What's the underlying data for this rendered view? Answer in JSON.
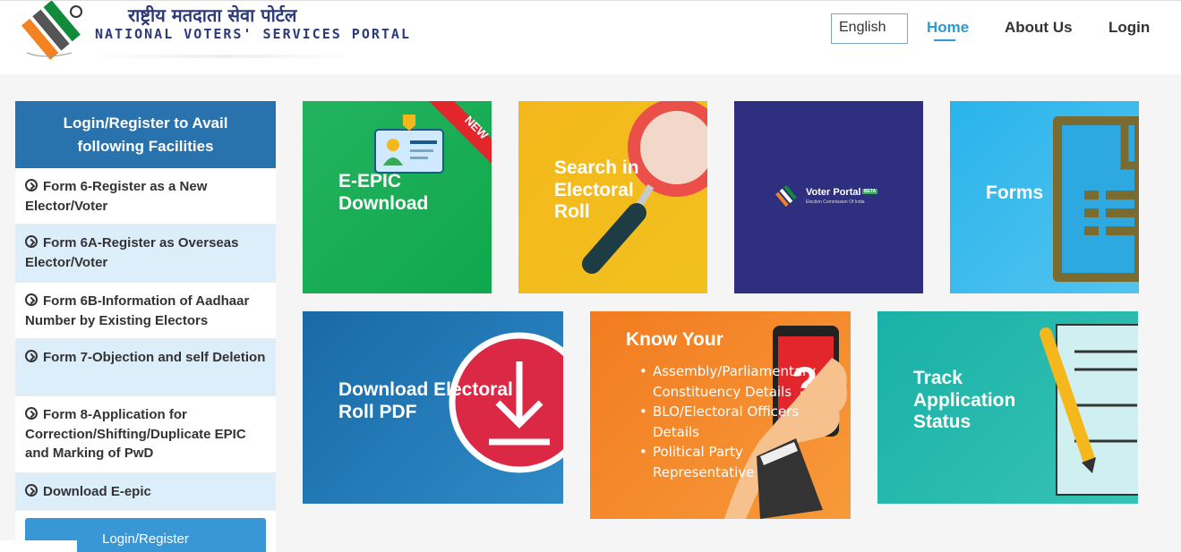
{
  "header": {
    "hindi_title": "राष्ट्रीय मतदाता सेवा पोर्टल",
    "english_title": "NATIONAL VOTERS' SERVICES PORTAL",
    "language": "English",
    "nav": {
      "home": "Home",
      "about": "About Us",
      "login": "Login"
    }
  },
  "sidebar": {
    "heading": "Login/Register to Avail following Facilities",
    "items": [
      {
        "label": "Form 6-Register as a New Elector/Voter"
      },
      {
        "label": "Form 6A-Register as Overseas Elector/Voter"
      },
      {
        "label": "Form 6B-Information of Aadhaar Number by Existing Electors"
      },
      {
        "label": "Form 7-Objection and self Deletion"
      },
      {
        "label": "Form 8-Application for Correction/Shifting/Duplicate EPIC and Marking of PwD"
      },
      {
        "label": "Download E-epic"
      }
    ],
    "button": "Login/Register"
  },
  "tiles": {
    "epic": {
      "title": "E-EPIC Download",
      "badge": "NEW"
    },
    "search": {
      "title": "Search in Electoral Roll"
    },
    "voter_portal": {
      "title": "Voter Portal",
      "badge": "BETA",
      "subtitle": "Election Commission Of India"
    },
    "forms": {
      "title": "Forms"
    },
    "download_roll": {
      "title": "Download Electoral Roll PDF"
    },
    "know": {
      "title": "Know Your",
      "items": [
        "Assembly/Parliamentary Constituency Details",
        "BLO/Electoral Officers Details",
        "Political Party Representative"
      ]
    },
    "track": {
      "title": "Track Application Status"
    }
  },
  "colors": {
    "primary": "#2872ad",
    "nav_active": "#2c9ad6",
    "sidebar_alt": "#ddeefb"
  }
}
